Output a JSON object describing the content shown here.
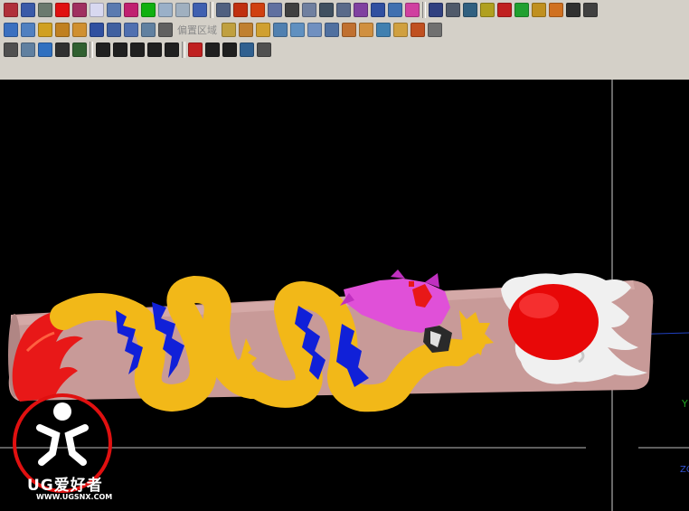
{
  "toolbar": {
    "offset_region_label": "偏置区域",
    "row1_icons": [
      {
        "name": "open-part-icon",
        "color": "#b0303a"
      },
      {
        "name": "layer-settings-icon",
        "color": "#3a5aa8"
      },
      {
        "name": "copy-layer-icon",
        "color": "#6b7a6e"
      },
      {
        "name": "red-square-icon",
        "color": "#e01010"
      },
      {
        "name": "grid-icon",
        "color": "#a03060"
      },
      {
        "name": "sheet-icon",
        "color": "#d8d8f0"
      },
      {
        "name": "snap-icon",
        "color": "#5a7ab0"
      },
      {
        "name": "curve-icon",
        "color": "#c02070"
      },
      {
        "name": "green-corner-icon",
        "color": "#10b010"
      },
      {
        "name": "trim-icon",
        "color": "#9ab0c8"
      },
      {
        "name": "edit-icon",
        "color": "#a0b0c0"
      },
      {
        "name": "point-icon",
        "color": "#4060b0"
      },
      {
        "name": "plane-icon",
        "color": "#506080"
      },
      {
        "name": "gear-red-icon",
        "color": "#c03010"
      },
      {
        "name": "gear-orange-icon",
        "color": "#d04010"
      },
      {
        "name": "shape-icon",
        "color": "#6070a0"
      },
      {
        "name": "dots-icon",
        "color": "#404040"
      },
      {
        "name": "link-icon",
        "color": "#7080a0"
      },
      {
        "name": "cube-outline-icon",
        "color": "#405060"
      },
      {
        "name": "frame-icon",
        "color": "#5a6a8a"
      },
      {
        "name": "purple-cube-icon",
        "color": "#8040a0"
      },
      {
        "name": "sphere-icon",
        "color": "#3050a0"
      },
      {
        "name": "box-icon",
        "color": "#4070b0"
      },
      {
        "name": "pink-grid-icon",
        "color": "#d040a0"
      },
      {
        "name": "diagonal-icon",
        "color": "#304080"
      },
      {
        "name": "list-icon",
        "color": "#505a6a"
      },
      {
        "name": "cross-box-icon",
        "color": "#306080"
      },
      {
        "name": "yellow-x-icon",
        "color": "#b0a020"
      },
      {
        "name": "red-cube-icon",
        "color": "#c02020"
      },
      {
        "name": "green-cube-icon",
        "color": "#20a030"
      },
      {
        "name": "gold-icon",
        "color": "#c09020"
      },
      {
        "name": "orange-icon",
        "color": "#d07020"
      },
      {
        "name": "dark-icon",
        "color": "#303030"
      },
      {
        "name": "bag-icon",
        "color": "#404040"
      }
    ],
    "row2_icons": [
      {
        "name": "folder-icon",
        "color": "#3a70c0"
      },
      {
        "name": "face-icon",
        "color": "#5080c0"
      },
      {
        "name": "yellow-shape-icon",
        "color": "#d0a020"
      },
      {
        "name": "solid-icon",
        "color": "#c08020"
      },
      {
        "name": "extrude-icon",
        "color": "#d09030"
      },
      {
        "name": "blue-block-icon",
        "color": "#3050a0"
      },
      {
        "name": "revolve-icon",
        "color": "#4060a0"
      },
      {
        "name": "sweep-icon",
        "color": "#5070b0"
      },
      {
        "name": "feature-icon",
        "color": "#6080a0"
      },
      {
        "name": "offset-icon",
        "color": "#606060"
      }
    ],
    "row2b_icons": [
      {
        "name": "thicken-icon",
        "color": "#c0a040"
      },
      {
        "name": "shell-icon",
        "color": "#c08030"
      },
      {
        "name": "surface-icon",
        "color": "#d0a030"
      },
      {
        "name": "sew-icon",
        "color": "#5080b0"
      },
      {
        "name": "patch-icon",
        "color": "#6090c0"
      },
      {
        "name": "blend-icon",
        "color": "#7090c0"
      },
      {
        "name": "chamfer-icon",
        "color": "#5070a0"
      },
      {
        "name": "face-blend-icon",
        "color": "#c07030"
      },
      {
        "name": "draft-icon",
        "color": "#d09040"
      },
      {
        "name": "trim-body-icon",
        "color": "#4080b0"
      },
      {
        "name": "box-3d-icon",
        "color": "#d0a040"
      },
      {
        "name": "shield-icon",
        "color": "#c05020"
      },
      {
        "name": "tool-icon",
        "color": "#707070"
      }
    ],
    "row3_icons": [
      {
        "name": "selection-box-icon",
        "color": "#505050"
      },
      {
        "name": "eraser-icon",
        "color": "#6080a0"
      },
      {
        "name": "cube-select-icon",
        "color": "#3070c0"
      },
      {
        "name": "dice-icon",
        "color": "#303030"
      },
      {
        "name": "points-icon",
        "color": "#306030"
      },
      {
        "name": "line-icon",
        "color": "#202020"
      },
      {
        "name": "line-diag-icon",
        "color": "#202020"
      },
      {
        "name": "arc-icon",
        "color": "#202020"
      },
      {
        "name": "tangent-icon",
        "color": "#202020"
      },
      {
        "name": "circle-target-icon",
        "color": "#202020"
      },
      {
        "name": "circle-icon",
        "color": "#c02020"
      },
      {
        "name": "crosshair-icon",
        "color": "#202020"
      },
      {
        "name": "slash-icon",
        "color": "#202020"
      },
      {
        "name": "analysis-icon",
        "color": "#306090"
      },
      {
        "name": "mesh-icon",
        "color": "#505050"
      }
    ]
  },
  "viewport": {
    "axis_y_label": "Y",
    "axis_z_label": "ZC"
  },
  "watermark": {
    "brand": "UG爱好者",
    "url": "WWW.UGSNX.COM"
  },
  "colors": {
    "toolbar_bg": "#d4d0c8",
    "viewport_bg": "#000000",
    "cylinder": "#c89a98",
    "dragon_body": "#f2b818",
    "dragon_fin": "#1020d8",
    "dragon_head": "#e050d8",
    "flame": "#e81818",
    "pearl": "#e80808",
    "cloud": "#f0f0f0",
    "watermark": "#e01010"
  }
}
